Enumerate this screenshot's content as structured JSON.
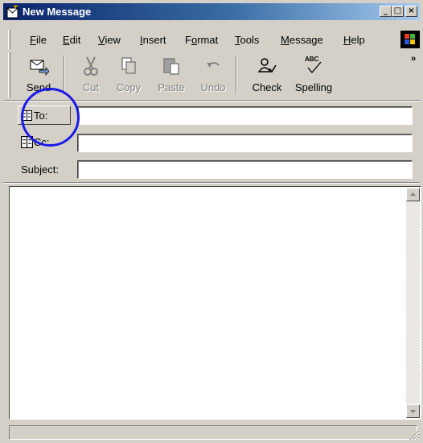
{
  "window": {
    "title": "New Message"
  },
  "title_buttons": {
    "minimize": "_",
    "maximize": "□",
    "close": "×"
  },
  "menu": {
    "items": [
      {
        "label_pre": "",
        "mnemonic": "F",
        "label_post": "ile"
      },
      {
        "label_pre": "",
        "mnemonic": "E",
        "label_post": "dit"
      },
      {
        "label_pre": "",
        "mnemonic": "V",
        "label_post": "iew"
      },
      {
        "label_pre": "",
        "mnemonic": "I",
        "label_post": "nsert"
      },
      {
        "label_pre": "F",
        "mnemonic": "o",
        "label_post": "rmat"
      },
      {
        "label_pre": "",
        "mnemonic": "T",
        "label_post": "ools"
      },
      {
        "label_pre": "",
        "mnemonic": "M",
        "label_post": "essage"
      },
      {
        "label_pre": "",
        "mnemonic": "H",
        "label_post": "elp"
      }
    ]
  },
  "toolbar": {
    "send": "Send",
    "cut": "Cut",
    "copy": "Copy",
    "paste": "Paste",
    "undo": "Undo",
    "check": "Check",
    "spelling": "Spelling",
    "spelling_icon_text": "ABC",
    "overflow": "»"
  },
  "header": {
    "to_label": "To:",
    "cc_label": "Cc:",
    "subject_label": "Subject:",
    "to_value": "",
    "cc_value": "",
    "subject_value": ""
  },
  "colors": {
    "highlight_circle": "#1a1ae6",
    "titlebar_start": "#0a246a",
    "titlebar_end": "#a6caf0"
  }
}
